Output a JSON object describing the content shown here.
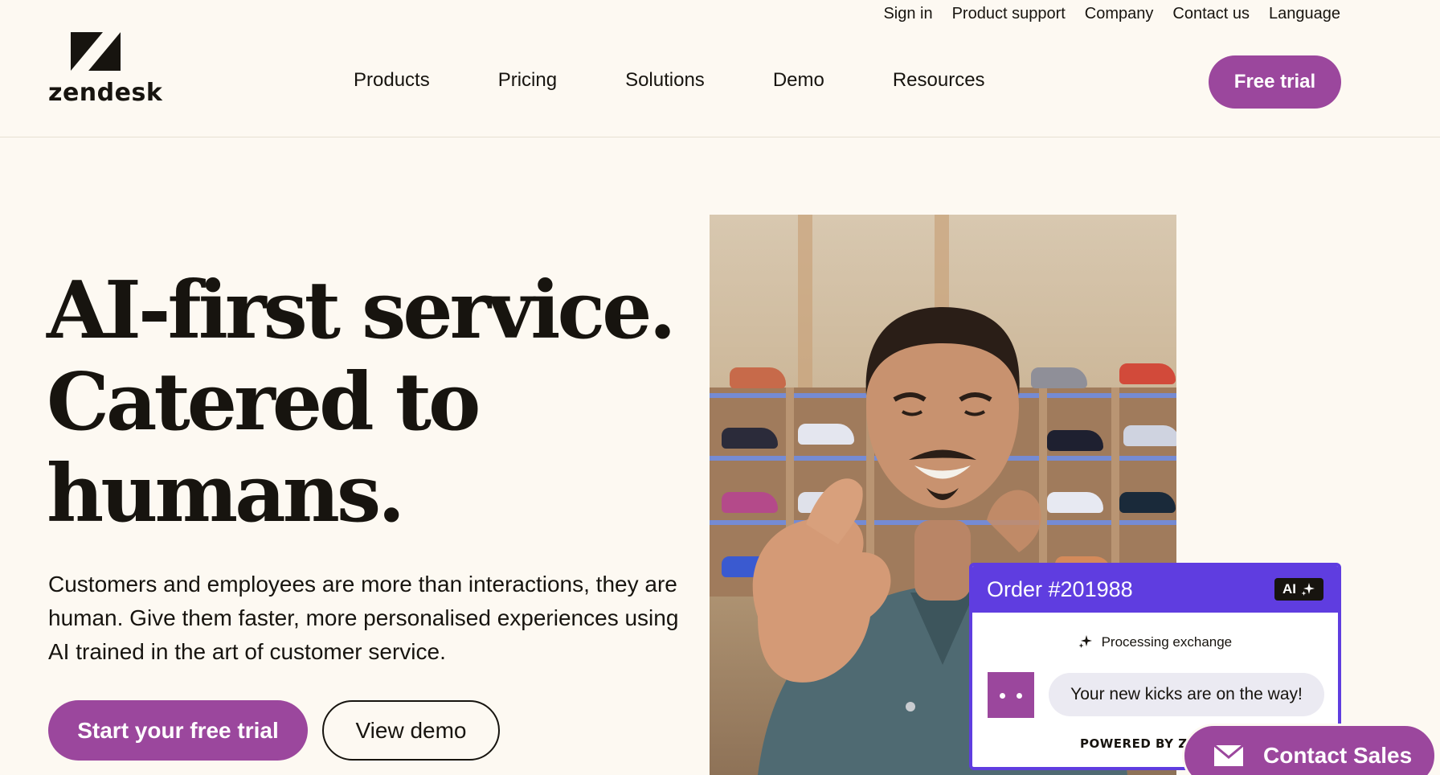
{
  "brand": {
    "name": "zendesk",
    "accent": "#9b479d",
    "card_accent": "#5f3de0"
  },
  "utility_nav": [
    "Sign in",
    "Product support",
    "Company",
    "Contact us",
    "Language"
  ],
  "main_nav": [
    "Products",
    "Pricing",
    "Solutions",
    "Demo",
    "Resources"
  ],
  "header_cta": "Free trial",
  "hero": {
    "title_lines": [
      "AI-first service.",
      "Catered to",
      "humans."
    ],
    "copy": "Customers and employees are more than interactions, they are human. Give them faster, more personalised experiences using AI trained in the art of customer service.",
    "primary_cta": "Start your free trial",
    "secondary_cta": "View demo"
  },
  "order_card": {
    "title": "Order #201988",
    "badge": "AI",
    "status": "Processing exchange",
    "message": "Your new kicks are on the way!",
    "powered_by": "POWERED BY ZENDESK"
  },
  "contact_sales": "Contact Sales",
  "icons": [
    "zendesk-logo-icon",
    "sparkle-icon",
    "mail-icon",
    "bot-avatar-icon"
  ]
}
